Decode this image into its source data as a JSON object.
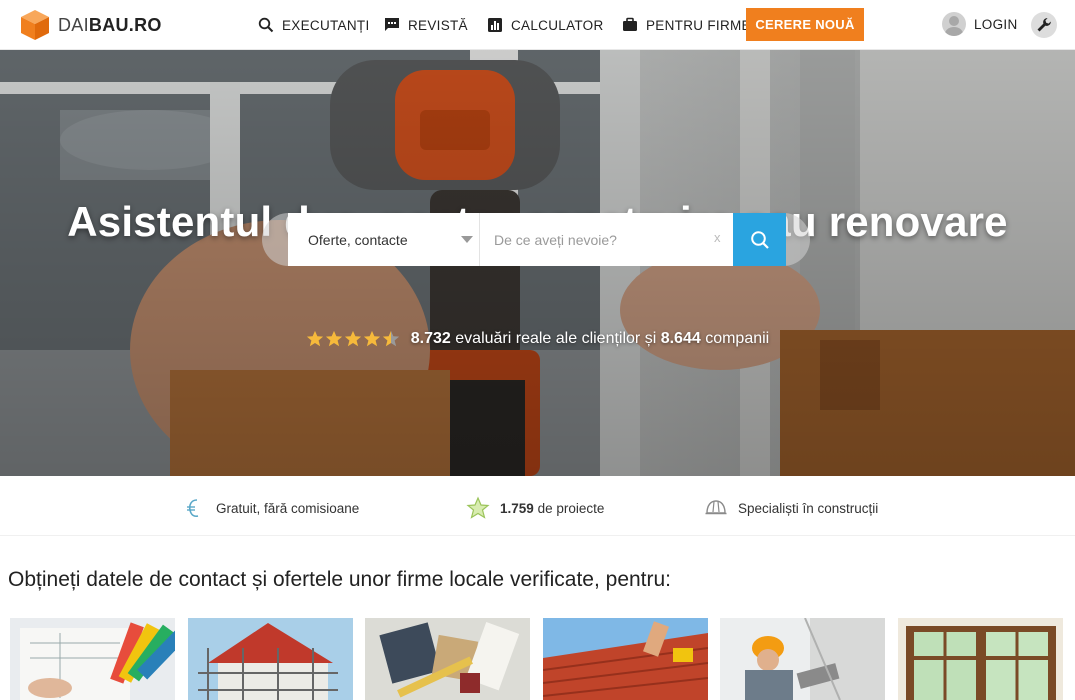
{
  "brand": {
    "logo_thin": "DAI",
    "logo_bold": "BAU.RO",
    "accent": "#f07f1e",
    "search_blue": "#2aa4e0"
  },
  "nav": {
    "executanti": "EXECUTANȚI",
    "revista": "REVISTĂ",
    "calculator": "CALCULATOR",
    "pentru_firme": "PENTRU FIRME",
    "cta": "CERERE NOUĂ",
    "login": "LOGIN"
  },
  "hero": {
    "title": "Asistentul dvs. pentru construire sau renovare",
    "search": {
      "select_value": "Oferte, contacte",
      "placeholder": "De ce aveți nevoie?",
      "clear": "x"
    },
    "rating": {
      "stars": 4.5,
      "reviews_count": "8.732",
      "reviews_text": "evaluări reale ale clienților și",
      "companies_count": "8.644",
      "companies_text": "companii"
    }
  },
  "features": [
    {
      "icon": "coin-icon",
      "text": "Gratuit, fără comisioane"
    },
    {
      "icon": "star-icon",
      "bold": "1.759",
      "text": "de proiecte"
    },
    {
      "icon": "helmet-icon",
      "text": "Specialiști în construcții"
    }
  ],
  "section_title": "Obțineți datele de contact și ofertele unor firme locale verificate, pentru:",
  "cards": [
    {
      "icon": "architecture-plans-image"
    },
    {
      "icon": "house-scaffolding-image"
    },
    {
      "icon": "design-tools-image"
    },
    {
      "icon": "roof-tiles-image"
    },
    {
      "icon": "plastering-worker-image"
    },
    {
      "icon": "window-frame-image"
    }
  ]
}
